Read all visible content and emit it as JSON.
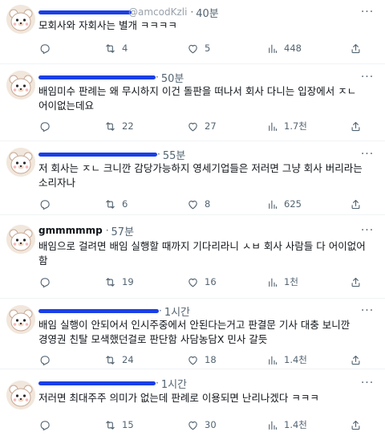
{
  "tweets": [
    {
      "handle_fragment": "@amcodKzli",
      "time": "40분",
      "text": "모회사와 자회사는 별개 ㅋㅋㅋㅋ",
      "replies": "",
      "retweets": "4",
      "likes": "5",
      "views": "448"
    },
    {
      "handle_fragment": "",
      "time": "50분",
      "text": "배임미수 판례는 왜 무시하지 이건 돌판을 떠나서 회사 다니는 입장에서 ㅈㄴ 어이없는데요",
      "replies": "",
      "retweets": "22",
      "likes": "27",
      "views": "1.7천"
    },
    {
      "handle_fragment": "",
      "time": "55분",
      "text": "저 회사는 ㅈㄴ 크니깐 감당가능하지 영세기업들은 저러면 그냥 회사 버리라는 소리자나",
      "replies": "",
      "retweets": "6",
      "likes": "8",
      "views": "625"
    },
    {
      "handle_fragment": "gmmmmmp",
      "time": "57분",
      "text": "배임으로 걸려면 배임 실행할 때까지 기다리라니 ㅅㅂ 회사 사람들 다 어이없어 함",
      "replies": "",
      "retweets": "19",
      "likes": "16",
      "views": "1천"
    },
    {
      "handle_fragment": "",
      "time": "1시간",
      "text": "배임 실행이 안되어서 인시주중에서 안된다는거고 판결문 기사 대충 보니깐 경영권 친탈 모색했던걸로 판단함 사담농담X 민사 갈듯",
      "replies": "",
      "retweets": "24",
      "likes": "18",
      "views": "1.4천"
    },
    {
      "handle_fragment": "",
      "time": "1시간",
      "text": "저러면 최대주주 의미가 없는데 판례로 이용되면 난리나겠다 ㅋㅋㅋ",
      "replies": "",
      "retweets": "15",
      "likes": "30",
      "views": "1.4천"
    }
  ],
  "icons": {
    "reply": "reply-icon",
    "retweet": "retweet-icon",
    "like": "heart-icon",
    "views": "views-icon",
    "share": "share-icon",
    "more": "more-icon"
  },
  "colors": {
    "text": "#0f1419",
    "muted": "#536471",
    "scribble": "#1a3fe6",
    "divider": "#eff3f4"
  }
}
